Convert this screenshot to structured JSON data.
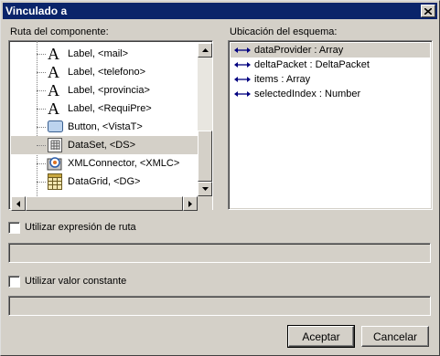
{
  "window": {
    "title": "Vinculado a"
  },
  "component_path": {
    "label": "Ruta del componente:",
    "items": [
      {
        "label": "Label, <mail>",
        "icon": "text-a-icon",
        "selected": false
      },
      {
        "label": "Label, <telefono>",
        "icon": "text-a-icon",
        "selected": false
      },
      {
        "label": "Label, <provincia>",
        "icon": "text-a-icon",
        "selected": false
      },
      {
        "label": "Label, <RequiPre>",
        "icon": "text-a-icon",
        "selected": false
      },
      {
        "label": "Button, <VistaT>",
        "icon": "button-icon",
        "selected": false
      },
      {
        "label": "DataSet, <DS>",
        "icon": "dataset-icon",
        "selected": true
      },
      {
        "label": "XMLConnector, <XMLC>",
        "icon": "xmlconnector-icon",
        "selected": false
      },
      {
        "label": "DataGrid, <DG>",
        "icon": "datagrid-icon",
        "selected": false
      }
    ]
  },
  "schema_location": {
    "label": "Ubicación del esquema:",
    "items": [
      {
        "label": "dataProvider : Array",
        "icon": "bidirectional-arrow-icon",
        "selected": true
      },
      {
        "label": "deltaPacket : DeltaPacket",
        "icon": "bidirectional-arrow-icon",
        "selected": false
      },
      {
        "label": "items : Array",
        "icon": "bidirectional-arrow-icon",
        "selected": false
      },
      {
        "label": "selectedIndex : Number",
        "icon": "bidirectional-arrow-icon",
        "selected": false
      }
    ]
  },
  "path_expression": {
    "label": "Utilizar expresión de ruta",
    "checked": false,
    "value": ""
  },
  "constant_value": {
    "label": "Utilizar valor constante",
    "checked": false,
    "value": ""
  },
  "buttons": {
    "accept": "Aceptar",
    "cancel": "Cancelar"
  },
  "colors": {
    "titlebar": "#0a246a",
    "face": "#d4d0c8",
    "arrow": "#000080"
  }
}
